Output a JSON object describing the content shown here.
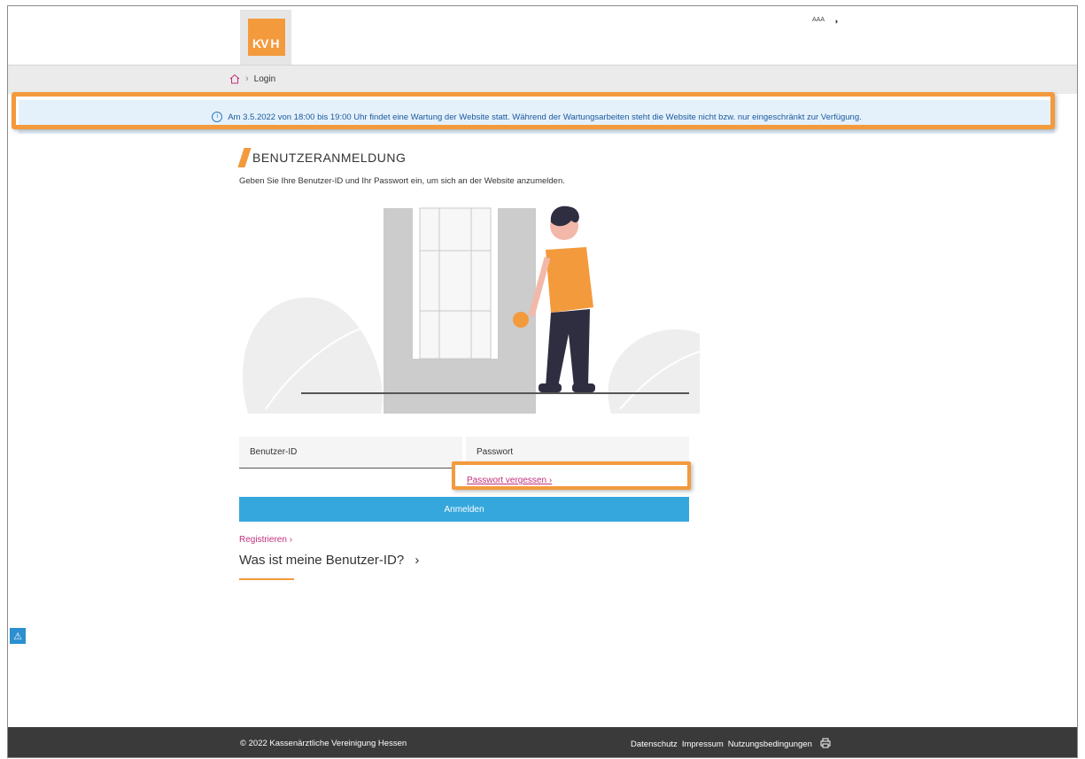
{
  "header": {
    "logo_text": "KV H",
    "font_size_tool": "AAA",
    "contrast_tool": "◑"
  },
  "breadcrumb": {
    "current": "Login"
  },
  "notice": {
    "text": "Am 3.5.2022 von 18:00 bis 19:00 Uhr findet eine Wartung der Website statt. Während der Wartungsarbeiten steht die Website nicht bzw. nur eingeschränkt zur Verfügung."
  },
  "login": {
    "title": "BENUTZERANMELDUNG",
    "subtitle": "Geben Sie Ihre Benutzer-ID und Ihr Passwort ein, um sich an der Website anzumelden.",
    "user_placeholder": "Benutzer-ID",
    "password_placeholder": "Passwort",
    "forgot_password": "Passwort vergessen",
    "submit": "Anmelden",
    "register": "Registrieren",
    "what_is_id": "Was ist meine Benutzer-ID?"
  },
  "footer": {
    "copyright": "© 2022 Kassenärztliche Vereinigung Hessen",
    "links": [
      "Datenschutz",
      "Impressum",
      "Nutzungsbedingungen"
    ]
  },
  "colors": {
    "accent": "#f39a3d",
    "primary_button": "#35a7dd",
    "link": "#c0307b",
    "notice_bg": "#e5f1fa"
  }
}
